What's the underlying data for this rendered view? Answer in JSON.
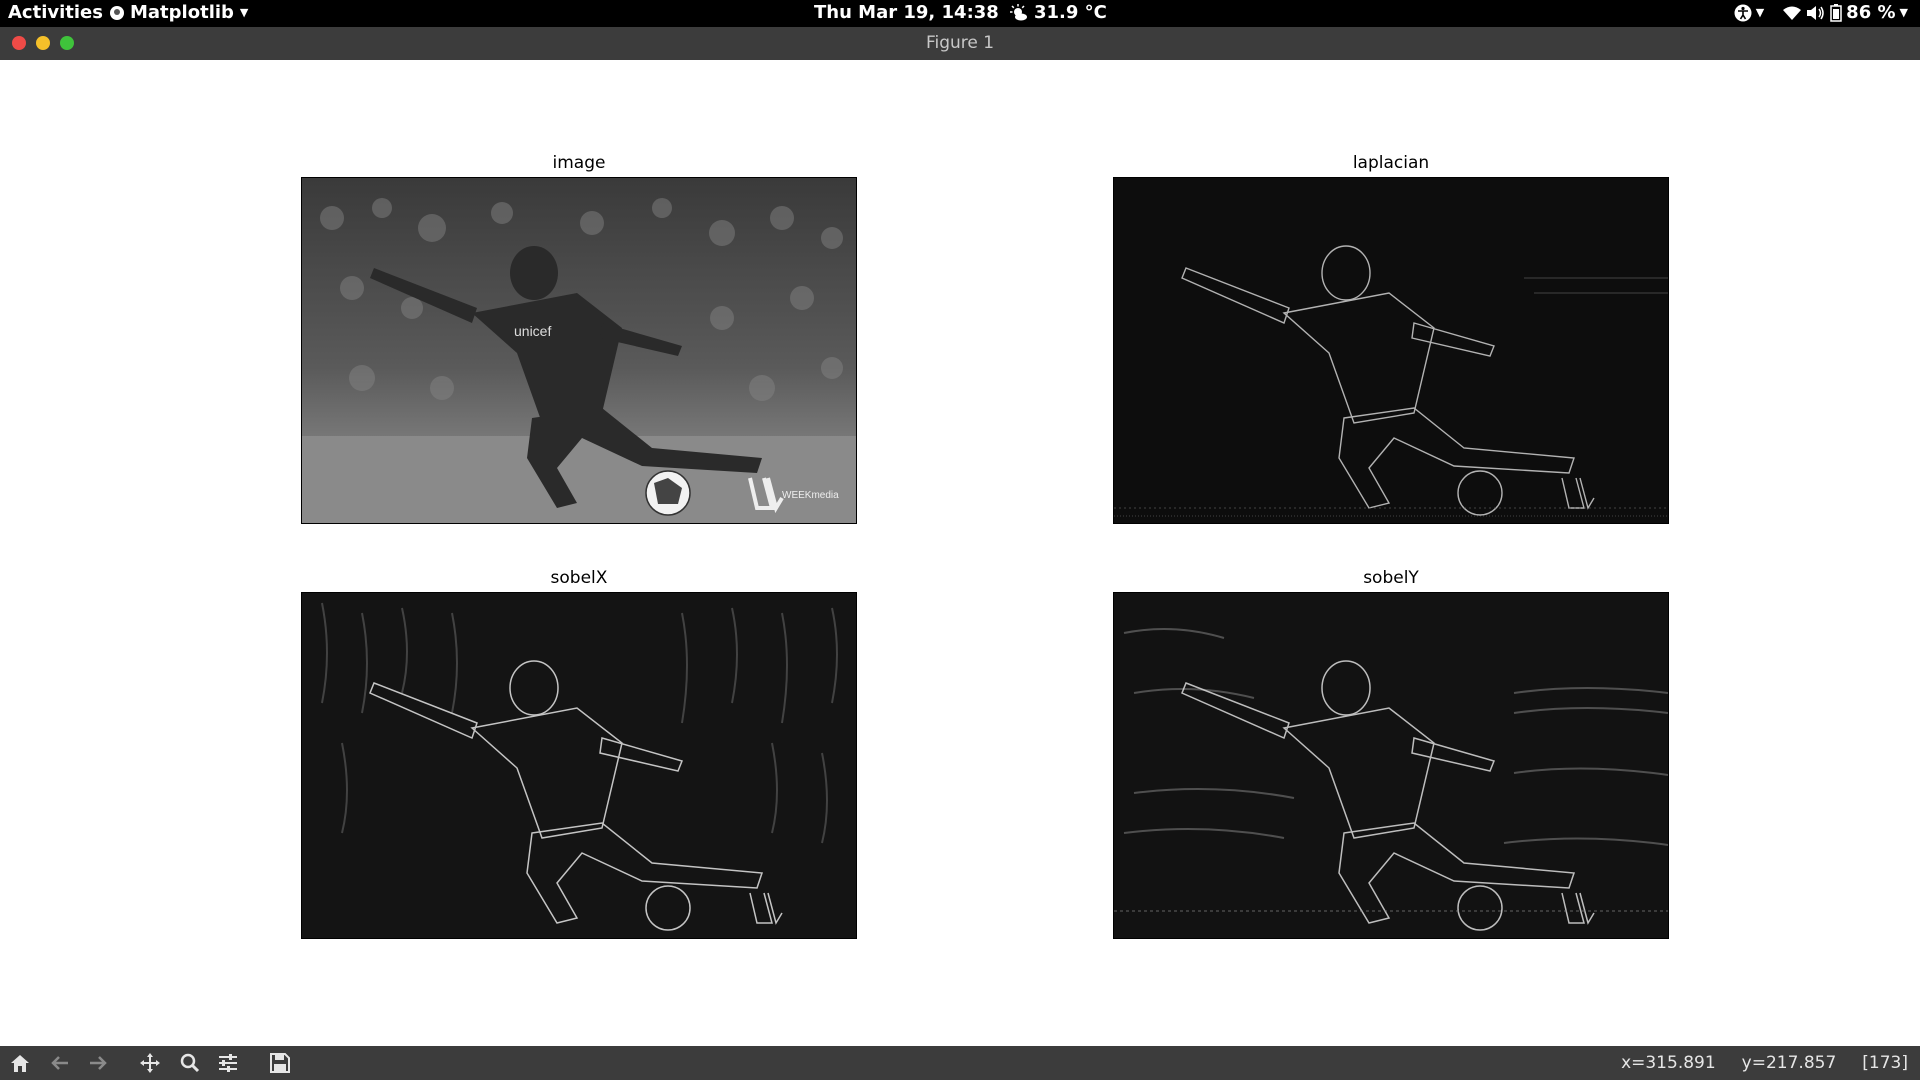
{
  "topbar": {
    "activities": "Activities",
    "app_name": "Matplotlib",
    "clock": "Thu Mar 19, 14:38",
    "weather": "31.9 °C",
    "battery": "86 %",
    "icons": [
      "accessibility-icon",
      "wifi-icon",
      "volume-icon",
      "battery-icon"
    ]
  },
  "window": {
    "title": "Figure 1"
  },
  "figure": {
    "subplots": [
      {
        "title": "image",
        "style": "grayscale"
      },
      {
        "title": "laplacian",
        "style": "edges-dark"
      },
      {
        "title": "sobelX",
        "style": "edges-dark"
      },
      {
        "title": "sobelY",
        "style": "edges-dark"
      }
    ],
    "watermark": "WEEKmedia",
    "shirt_text": "unicef"
  },
  "toolbar": {
    "tools": [
      "home-icon",
      "back-icon",
      "forward-icon",
      "pan-icon",
      "zoom-icon",
      "configure-subplots-icon",
      "save-icon"
    ],
    "x": "x=315.891",
    "y": "y=217.857",
    "value": "[173]"
  },
  "colors": {
    "topbar_bg": "#000000",
    "titlebar_bg": "#3c3c3c",
    "close": "#ef4b47",
    "minimize": "#f5c02a",
    "maximize": "#3fc33b"
  }
}
